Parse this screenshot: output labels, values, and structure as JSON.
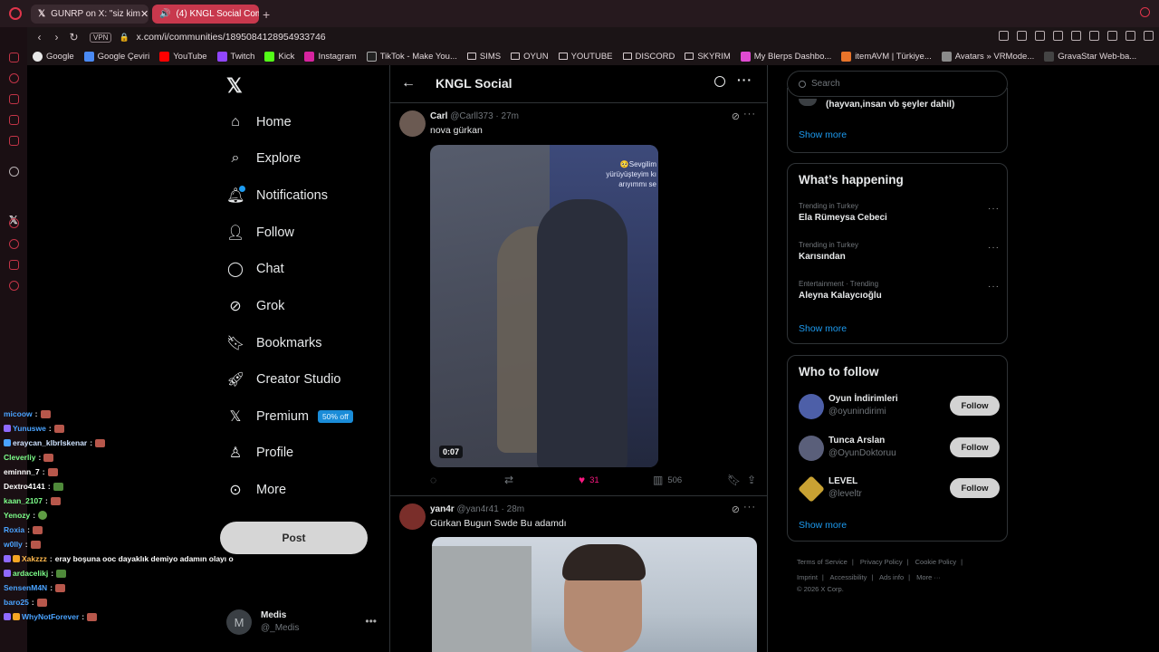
{
  "browser": {
    "tabs": [
      {
        "label": "GUNRP on X: \"siz kim",
        "icon": "x-logo-icon"
      },
      {
        "label": "(4) KNGL Social Comm",
        "icon": "speaker-icon"
      }
    ],
    "new_tab": "+",
    "vpn_label": "VPN",
    "url": "x.com/i/communities/1895084128954933746",
    "bookmarks": [
      "Google",
      "Google Çeviri",
      "YouTube",
      "Twitch",
      "Kick",
      "Instagram",
      "TikTok - Make You...",
      "SIMS",
      "OYUN",
      "YOUTUBE",
      "DISCORD",
      "SKYRIM",
      "My Blerps Dashbo...",
      "itemAVM | Türkiye...",
      "Avatars » VRMode...",
      "GravaStar Web-ba..."
    ]
  },
  "chat": [
    {
      "user": "micoow",
      "msg": "",
      "color": "#4aa3ff"
    },
    {
      "user": "Yunuswe",
      "msg": "",
      "color": "#4aa3ff"
    },
    {
      "user": "eraycan_klbrlskenar",
      "msg": "",
      "color": "#cfe3ff"
    },
    {
      "user": "Cleverliy",
      "msg": "",
      "color": "#7dff8a"
    },
    {
      "user": "eminnn_7",
      "msg": "",
      "color": "#ffffff"
    },
    {
      "user": "Dextro4141",
      "msg": "",
      "color": "#ffffff"
    },
    {
      "user": "kaan_2107",
      "msg": "",
      "color": "#7dff8a"
    },
    {
      "user": "Yenozy",
      "msg": "",
      "color": "#7dff8a"
    },
    {
      "user": "Roxia",
      "msg": "",
      "color": "#4aa3ff"
    },
    {
      "user": "w0lly",
      "msg": "",
      "color": "#4aa3ff"
    },
    {
      "user": "Xakzzz",
      "msg": "eray boşuna ooc dayaklık demiyo adamın olayı o",
      "color": "#ffb84d"
    },
    {
      "user": "ardacelikj",
      "msg": "",
      "color": "#7dff8a"
    },
    {
      "user": "SensenM4N",
      "msg": "",
      "color": "#4aa3ff"
    },
    {
      "user": "baro25",
      "msg": "",
      "color": "#4aa3ff"
    },
    {
      "user": "WhyNotForever",
      "msg": "",
      "color": "#4aa3ff"
    }
  ],
  "nav": {
    "items": [
      {
        "label": "Home",
        "icon": "home-icon"
      },
      {
        "label": "Explore",
        "icon": "search-icon"
      },
      {
        "label": "Notifications",
        "icon": "bell-icon"
      },
      {
        "label": "Follow",
        "icon": "person-add-icon"
      },
      {
        "label": "Chat",
        "icon": "chat-icon"
      },
      {
        "label": "Grok",
        "icon": "grok-icon"
      },
      {
        "label": "Bookmarks",
        "icon": "bookmark-icon"
      },
      {
        "label": "Creator Studio",
        "icon": "rocket-icon"
      },
      {
        "label": "Premium",
        "icon": "x-icon"
      },
      {
        "label": "Profile",
        "icon": "person-icon"
      },
      {
        "label": "More",
        "icon": "more-circle-icon"
      }
    ],
    "premium_badge": "50% off",
    "post_label": "Post",
    "account": {
      "name": "Medis",
      "handle": "@_Medis",
      "initial": "M"
    }
  },
  "feed": {
    "title": "KNGL Social",
    "tweets": [
      {
        "name": "Carl",
        "handle": "@Carll373",
        "time": "27m",
        "text": "nova gürkan",
        "video_caption": [
          "🥺Sevgilim",
          "yürüyüşteyim kı",
          "arıyımmı se"
        ],
        "duration": "0:07",
        "likes": "31",
        "views": "506"
      },
      {
        "name": "yan4r",
        "handle": "@yan4r41",
        "time": "28m",
        "text": "Gürkan Bugun Swde Bu adamdı"
      }
    ]
  },
  "right": {
    "search_placeholder": "Search",
    "prev_card_text": "(hayvan,insan vb şeyler dahil)",
    "show_more": "Show more",
    "whats_happening_title": "What’s happening",
    "trends": [
      {
        "meta": "Trending in Turkey",
        "name": "Ela Rümeysa Cebeci"
      },
      {
        "meta": "Trending in Turkey",
        "name": "Karısından"
      },
      {
        "meta": "Entertainment · Trending",
        "name": "Aleyna Kalaycıoğlu"
      }
    ],
    "who_to_follow_title": "Who to follow",
    "suggestions": [
      {
        "name": "Oyun İndirimleri",
        "handle": "@oyunindirimi",
        "color": "#4d5fa8"
      },
      {
        "name": "Tunca Arslan",
        "handle": "@OyunDoktoruu",
        "color": "#5a5f7a"
      },
      {
        "name": "LEVEL",
        "handle": "@leveltr",
        "color": "#c9a233"
      }
    ],
    "follow_label": "Follow",
    "footer": [
      "Terms of Service",
      "Privacy Policy",
      "Cookie Policy",
      "Imprint",
      "Accessibility",
      "Ads info",
      "More ···",
      "© 2026 X Corp."
    ]
  }
}
